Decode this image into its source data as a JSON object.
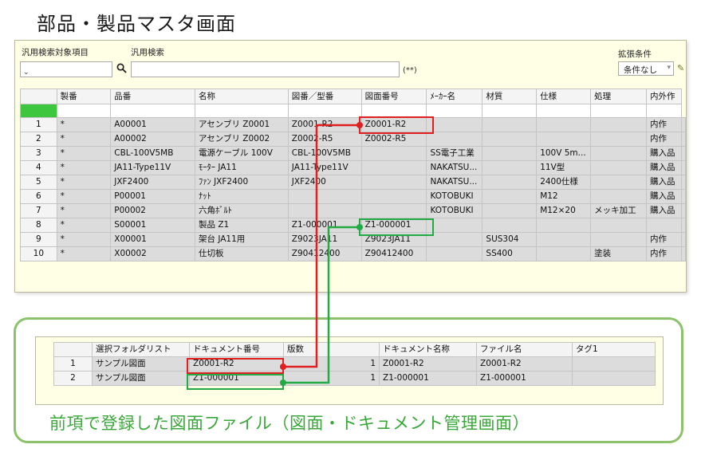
{
  "page_title": "部品・製品マスタ画面",
  "search": {
    "target_label": "汎用検索対象項目",
    "search_label": "汎用検索",
    "search_value": "",
    "hint": "(**)",
    "ext_label": "拡張条件",
    "ext_value": "条件なし"
  },
  "main_table": {
    "headers": [
      "製番",
      "品番",
      "名称",
      "図番／型番",
      "図面番号",
      "ﾒｰｶｰ名",
      "材質",
      "仕様",
      "処理",
      "内外作"
    ],
    "rows": [
      {
        "no": "1",
        "seiban": "*",
        "hinban": "A00001",
        "name": "アセンブリ Z0001",
        "zuban": "Z0001-R2",
        "zumen": "Z0001-R2",
        "maker": "",
        "material": "",
        "spec": "",
        "process": "",
        "inout": "内作"
      },
      {
        "no": "2",
        "seiban": "*",
        "hinban": "A00002",
        "name": "アセンブリ Z0002",
        "zuban": "Z0002-R5",
        "zumen": "Z0002-R5",
        "maker": "",
        "material": "",
        "spec": "",
        "process": "",
        "inout": "内作"
      },
      {
        "no": "3",
        "seiban": "*",
        "hinban": "CBL-100V5MB",
        "name": "電源ケーブル 100V",
        "zuban": "CBL-100V5MB",
        "zumen": "",
        "maker": "SS電子工業",
        "material": "",
        "spec": "100V 5m...",
        "process": "",
        "inout": "購入品"
      },
      {
        "no": "4",
        "seiban": "*",
        "hinban": "JA11-Type11V",
        "name": "ﾓｰﾀｰ JA11",
        "zuban": "JA11-Type11V",
        "zumen": "",
        "maker": "NAKATSU...",
        "material": "",
        "spec": "11V型",
        "process": "",
        "inout": "購入品"
      },
      {
        "no": "5",
        "seiban": "*",
        "hinban": "JXF2400",
        "name": "ﾌｧﾝ JXF2400",
        "zuban": "JXF2400",
        "zumen": "",
        "maker": "NAKATSU...",
        "material": "",
        "spec": "2400仕様",
        "process": "",
        "inout": "購入品"
      },
      {
        "no": "6",
        "seiban": "*",
        "hinban": "P00001",
        "name": "ﾅｯﾄ",
        "zuban": "",
        "zumen": "",
        "maker": "KOTOBUKI",
        "material": "",
        "spec": "M12",
        "process": "",
        "inout": "購入品"
      },
      {
        "no": "7",
        "seiban": "*",
        "hinban": "P00002",
        "name": "六角ﾎﾞﾙﾄ",
        "zuban": "",
        "zumen": "",
        "maker": "KOTOBUKI",
        "material": "",
        "spec": "M12×20",
        "process": "メッキ加工",
        "inout": "購入品"
      },
      {
        "no": "8",
        "seiban": "*",
        "hinban": "S00001",
        "name": "製品 Z1",
        "zuban": "Z1-000001",
        "zumen": "Z1-000001",
        "maker": "",
        "material": "",
        "spec": "",
        "process": "",
        "inout": ""
      },
      {
        "no": "9",
        "seiban": "*",
        "hinban": "X00001",
        "name": "架台 JA11用",
        "zuban": "Z9023JA11",
        "zumen": "Z9023JA11",
        "maker": "",
        "material": "SUS304",
        "spec": "",
        "process": "",
        "inout": "内作"
      },
      {
        "no": "10",
        "seiban": "*",
        "hinban": "X00002",
        "name": "仕切板",
        "zuban": "Z90412400",
        "zumen": "Z90412400",
        "maker": "",
        "material": "SS400",
        "spec": "",
        "process": "塗装",
        "inout": "内作"
      }
    ]
  },
  "doc_table": {
    "headers": [
      "選択フォルダリスト",
      "ドキュメント番号",
      "版数",
      "ドキュメント名称",
      "ファイル名",
      "タグ1"
    ],
    "rows": [
      {
        "no": "1",
        "folder": "サンプル図面",
        "docno": "Z0001-R2",
        "rev": "1",
        "docname": "Z0001-R2",
        "file": "Z0001-R2",
        "tag": ""
      },
      {
        "no": "2",
        "folder": "サンプル図面",
        "docno": "Z1-000001",
        "rev": "1",
        "docname": "Z1-000001",
        "file": "Z1-000001",
        "tag": ""
      }
    ]
  },
  "caption": "前項で登録した図面ファイル（図面・ドキュメント管理画面）",
  "colors": {
    "red_link": "#e02020",
    "green_link": "#22aa44",
    "panel_bg": "#ffffe6",
    "green_border": "#8cc26a",
    "caption_green": "#39a839"
  }
}
